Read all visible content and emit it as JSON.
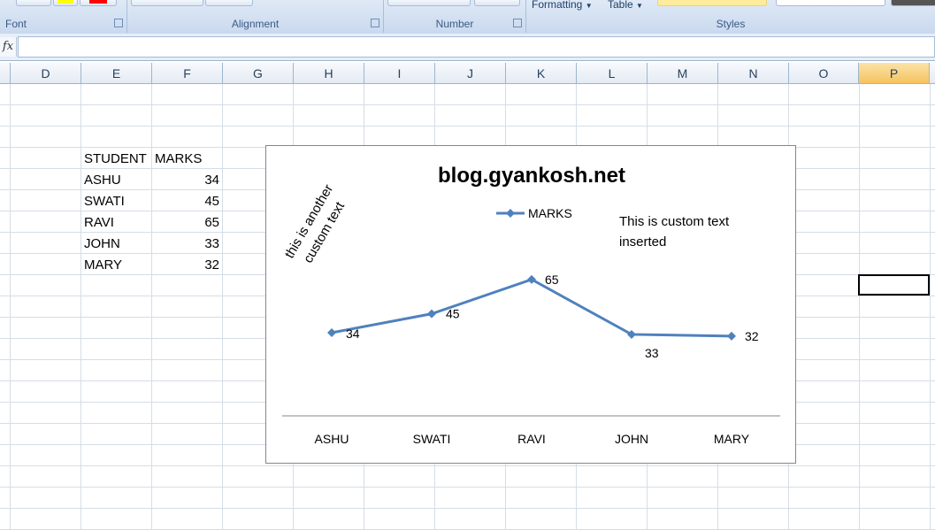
{
  "ribbon": {
    "groups": {
      "font": "Font",
      "alignment": "Alignment",
      "number": "Number",
      "styles": "Styles"
    },
    "formatting_label": "Formatting",
    "table_label": "Table",
    "font_color_swatch": "#ff0000",
    "highlight_swatch": "#ffff00"
  },
  "formula_bar": {
    "fx_label": "fx",
    "value": ""
  },
  "columns": [
    "D",
    "E",
    "F",
    "G",
    "H",
    "I",
    "J",
    "K",
    "L",
    "M",
    "N",
    "O",
    "P"
  ],
  "selected_column": "P",
  "table": {
    "headers": [
      "STUDENT",
      "MARKS"
    ],
    "rows": [
      {
        "name": "ASHU",
        "marks": "34"
      },
      {
        "name": "SWATI",
        "marks": "45"
      },
      {
        "name": "RAVI",
        "marks": "65"
      },
      {
        "name": "JOHN",
        "marks": "33"
      },
      {
        "name": "MARY",
        "marks": "32"
      }
    ]
  },
  "chart_data": {
    "type": "line",
    "title": "blog.gyankosh.net",
    "categories": [
      "ASHU",
      "SWATI",
      "RAVI",
      "JOHN",
      "MARY"
    ],
    "series": [
      {
        "name": "MARKS",
        "values": [
          34,
          45,
          65,
          33,
          32
        ],
        "color": "#4f81bd"
      }
    ],
    "data_labels": [
      "34",
      "45",
      "65",
      "33",
      "32"
    ],
    "legend_position": "top",
    "annotations": [
      "This is custom text inserted",
      "this is another custom text"
    ],
    "annotation_lines": [
      [
        "This is custom text",
        "inserted"
      ],
      [
        "this is another",
        "custom text"
      ]
    ],
    "grid": false
  }
}
